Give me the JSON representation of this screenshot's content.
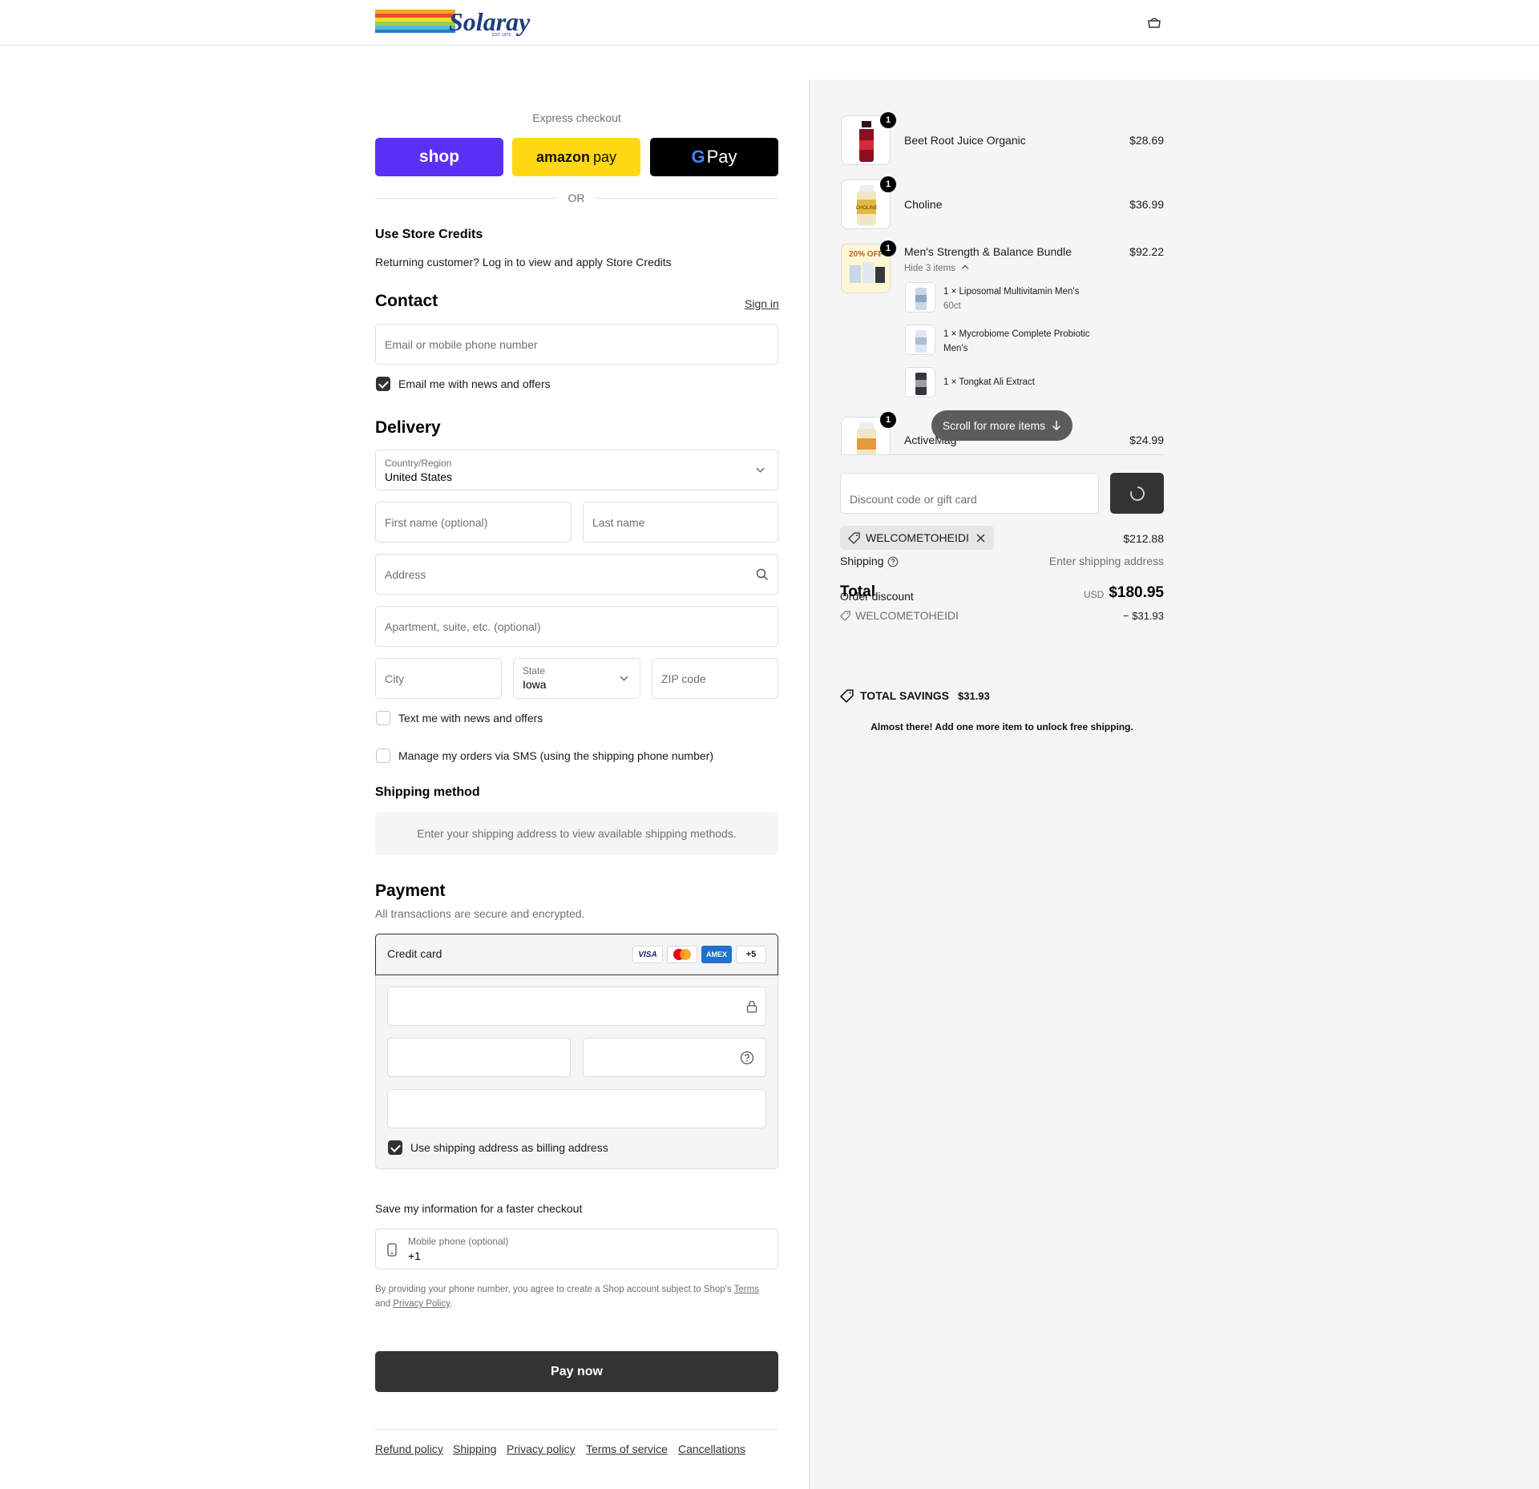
{
  "brand": {
    "name": "Solaray",
    "tagline": "EST. 1973"
  },
  "express": {
    "title": "Express checkout",
    "shop_label": "shop",
    "amazon_label": "amazon",
    "amazon_label2": "pay",
    "gpay_g": "G",
    "gpay_label": "Pay",
    "or_label": "OR"
  },
  "store_credits": {
    "title": "Use Store Credits",
    "text": "Returning customer? Log in to view and apply Store Credits"
  },
  "contact": {
    "title": "Contact",
    "sign_in": "Sign in",
    "email_placeholder": "Email or mobile phone number",
    "email_offers": "Email me with news and offers"
  },
  "delivery": {
    "title": "Delivery",
    "country_label": "Country/Region",
    "country_value": "United States",
    "first_name_placeholder": "First name (optional)",
    "last_name_placeholder": "Last name",
    "address_placeholder": "Address",
    "apartment_placeholder": "Apartment, suite, etc. (optional)",
    "city_placeholder": "City",
    "state_label": "State",
    "state_value": "Iowa",
    "zip_placeholder": "ZIP code",
    "text_offers": "Text me with news and offers",
    "sms_orders": "Manage my orders via SMS (using the shipping phone number)"
  },
  "shipping_method": {
    "title": "Shipping method",
    "notice": "Enter your shipping address to view available shipping methods."
  },
  "payment": {
    "title": "Payment",
    "subtitle": "All transactions are secure and encrypted.",
    "credit_card": "Credit card",
    "visa": "VISA",
    "amex": "AMEX",
    "more_cards": "+5",
    "billing_same": "Use shipping address as billing address"
  },
  "save_info": {
    "title": "Save my information for a faster checkout",
    "phone_label": "Mobile phone (optional)",
    "phone_value": "+1",
    "legal_1": "By providing your phone number, you agree to create a Shop account subject to Shop's",
    "terms": "Terms",
    "legal_and": "and",
    "privacy": "Privacy Policy",
    "legal_end": "."
  },
  "pay_now": "Pay now",
  "footer": [
    "Refund policy",
    "Shipping",
    "Privacy policy",
    "Terms of service",
    "Cancellations"
  ],
  "cart": {
    "items": [
      {
        "name": "Beet Root Juice Organic",
        "qty": "1",
        "price": "$28.69"
      },
      {
        "name": "Choline",
        "qty": "1",
        "price": "$36.99"
      },
      {
        "name": "Men's Strength & Balance Bundle",
        "qty": "1",
        "price": "$92.22",
        "toggle": "Hide 3 items",
        "promo": "20% OFF"
      },
      {
        "name": "ActiveMag",
        "qty": "1",
        "price": "$24.99"
      }
    ],
    "bundle_items": [
      {
        "qty": "1 ×",
        "line1": "Liposomal Multivitamin Men's",
        "line2": "60ct"
      },
      {
        "qty": "1 ×",
        "line1": "Mycrobiome Complete Probiotic",
        "line2": "Men's"
      },
      {
        "qty": "1 ×",
        "line1": "Tongkat Ali Extract",
        "line2": ""
      }
    ],
    "scroll_hint": "Scroll for more items"
  },
  "summary": {
    "discount_placeholder": "Discount code or gift card",
    "applied_code": "WELCOMETOHEIDI",
    "subtotal": "$212.88",
    "shipping_label": "Shipping",
    "shipping_value": "Enter shipping address",
    "total_label": "Total",
    "order_discount_label": "Order discount",
    "currency": "USD",
    "total_value": "$180.95",
    "discount_code": "WELCOMETOHEIDI",
    "discount_value": "− $31.93",
    "savings_label": "TOTAL SAVINGS",
    "savings_value": "$31.93",
    "free_shipping_msg": "Almost there! Add one more item to unlock free shipping."
  },
  "colors": {
    "shop_purple": "#5a31f4",
    "amazon_yellow": "#ffd814",
    "gpay_black": "#000000",
    "button_dark": "#333333",
    "panel_bg": "#f5f5f5"
  }
}
